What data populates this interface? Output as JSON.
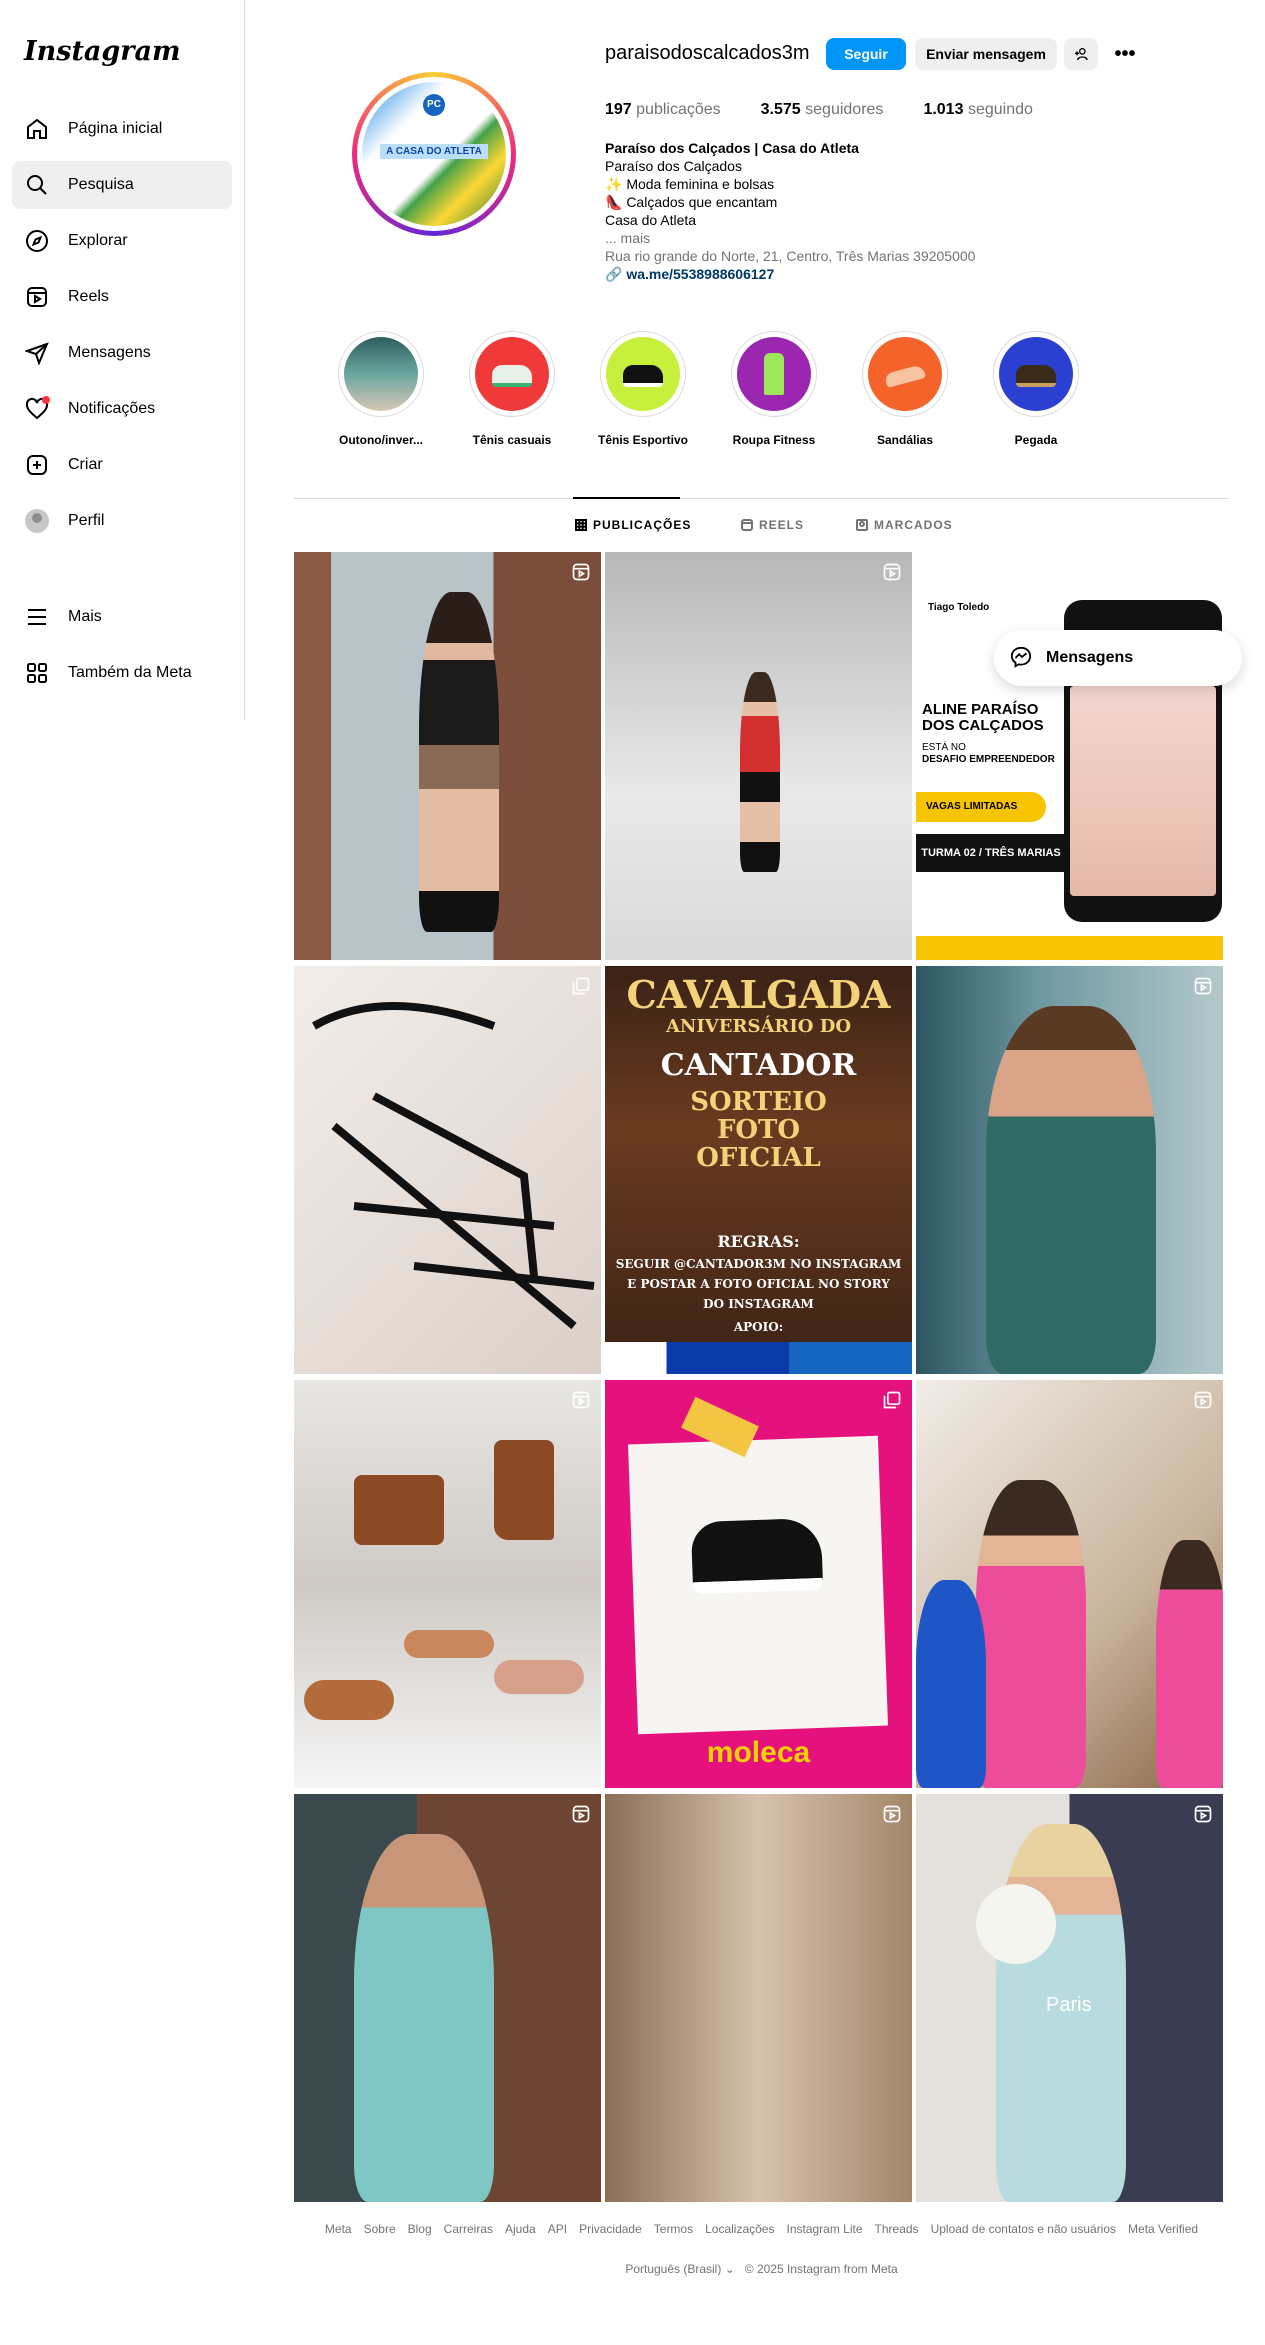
{
  "app": {
    "logo": "Instagram"
  },
  "sidebar": {
    "items": [
      {
        "label": "Página inicial",
        "icon": "home-icon"
      },
      {
        "label": "Pesquisa",
        "icon": "search-icon"
      },
      {
        "label": "Explorar",
        "icon": "compass-icon"
      },
      {
        "label": "Reels",
        "icon": "reels-icon"
      },
      {
        "label": "Mensagens",
        "icon": "send-icon"
      },
      {
        "label": "Notificações",
        "icon": "heart-icon"
      },
      {
        "label": "Criar",
        "icon": "plus-square-icon"
      },
      {
        "label": "Perfil",
        "icon": "avatar"
      }
    ],
    "more": "Mais",
    "meta": "Também da Meta"
  },
  "profile": {
    "username": "paraisodoscalcados3m",
    "follow_label": "Seguir",
    "message_label": "Enviar mensagem",
    "more_label": "•••",
    "picture_badge": "PC",
    "picture_text": "A CASA DO ATLETA",
    "stats": {
      "posts_count": "197",
      "posts_label": "publicações",
      "followers_count": "3.575",
      "followers_label": "seguidores",
      "following_count": "1.013",
      "following_label": "seguindo"
    },
    "bio": {
      "name": "Paraíso dos Calçados | Casa do Atleta",
      "line1": "Paraíso dos Calçados",
      "line2": "✨ Moda feminina e bolsas",
      "line3": "👠 Calçados que encantam",
      "line4": "Casa do Atleta",
      "more": "... mais",
      "address": "Rua rio grande do Norte, 21, Centro, Três Marias 39205000",
      "link": "wa.me/5538988606127"
    }
  },
  "highlights": [
    {
      "label": "Outono/inver...",
      "color": "#3d6b6a"
    },
    {
      "label": "Tênis casuais",
      "color": "#f03a3a"
    },
    {
      "label": "Tênis Esportivo",
      "color": "#c6f03c"
    },
    {
      "label": "Roupa Fitness",
      "color": "#9b27b0"
    },
    {
      "label": "Sandálias",
      "color": "#f4632a"
    },
    {
      "label": "Pegada",
      "color": "#2b3fd1"
    }
  ],
  "tabs": [
    {
      "label": "PUBLICAÇÕES",
      "active": true
    },
    {
      "label": "REELS",
      "active": false
    },
    {
      "label": "MARCADOS",
      "active": false
    }
  ],
  "posts": {
    "p3": {
      "brand": "Tiago Toledo",
      "headline": "ALINE PARAÍSO DOS CALÇADOS",
      "sub1": "ESTÁ NO",
      "sub2": "DESAFIO EMPREENDEDOR",
      "badge": "VAGAS LIMITADAS",
      "turma": "TURMA 02 / TRÊS MARIAS"
    },
    "p5": {
      "title": "CAVALGADA",
      "sub": "ANIVERSÁRIO DO",
      "name": "CANTADOR",
      "raffle": "SORTEIO FOTO OFICIAL",
      "rules_title": "REGRAS:",
      "rules": "SEGUIR @CANTADOR3M NO INSTAGRAM E POSTAR A FOTO OFICIAL NO STORY DO INSTAGRAM",
      "support": "APOIO:"
    },
    "p8": {
      "brand": "moleca"
    },
    "p12": {
      "overlay": "Paris"
    }
  },
  "messages_pill": "Mensagens",
  "footer": {
    "links": [
      "Meta",
      "Sobre",
      "Blog",
      "Carreiras",
      "Ajuda",
      "API",
      "Privacidade",
      "Termos",
      "Localizações",
      "Instagram Lite",
      "Threads",
      "Upload de contatos e não usuários",
      "Meta Verified"
    ],
    "language": "Português (Brasil)",
    "copyright": "© 2025 Instagram from Meta"
  }
}
